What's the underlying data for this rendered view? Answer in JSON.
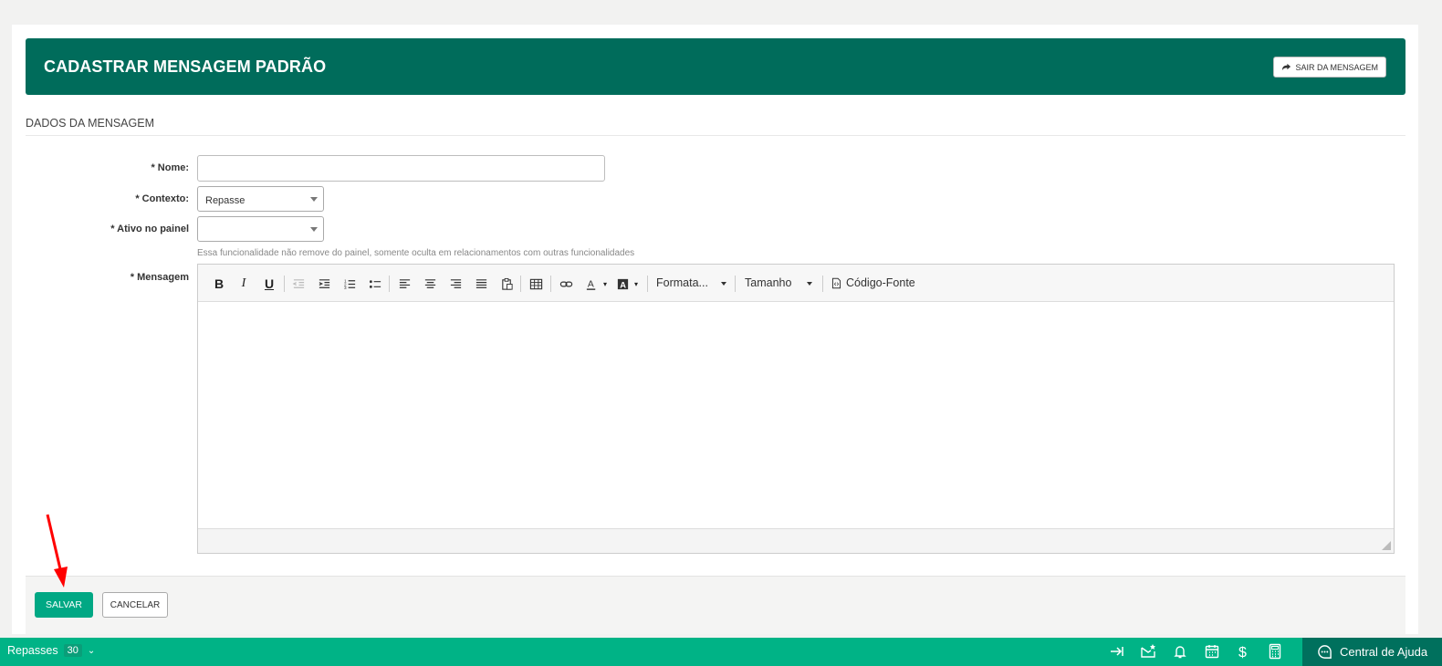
{
  "header": {
    "title": "CADASTRAR MENSAGEM PADRÃO",
    "exit_label": "SAIR DA MENSAGEM"
  },
  "section": {
    "title": "DADOS DA MENSAGEM"
  },
  "form": {
    "nome": {
      "label": "* Nome:",
      "value": ""
    },
    "contexto": {
      "label": "* Contexto:",
      "value": "Repasse"
    },
    "ativo": {
      "label": "* Ativo no painel",
      "value": ""
    },
    "hint": "Essa funcionalidade não remove do painel, somente oculta em relacionamentos com outras funcionalidades",
    "mensagem": {
      "label": "* Mensagem"
    }
  },
  "editor": {
    "format_label": "Formata...",
    "size_label": "Tamanho",
    "source_label": "Código-Fonte"
  },
  "actions": {
    "save_label": "SALVAR",
    "cancel_label": "CANCELAR"
  },
  "bottom_bar": {
    "module": "Repasses",
    "count": "30",
    "help_label": "Central de Ajuda"
  },
  "colors": {
    "header": "#006c5b",
    "accent": "#00a884",
    "bottom_bar": "#00b386",
    "help": "#00705d",
    "annotation_arrow": "#ff0000"
  }
}
